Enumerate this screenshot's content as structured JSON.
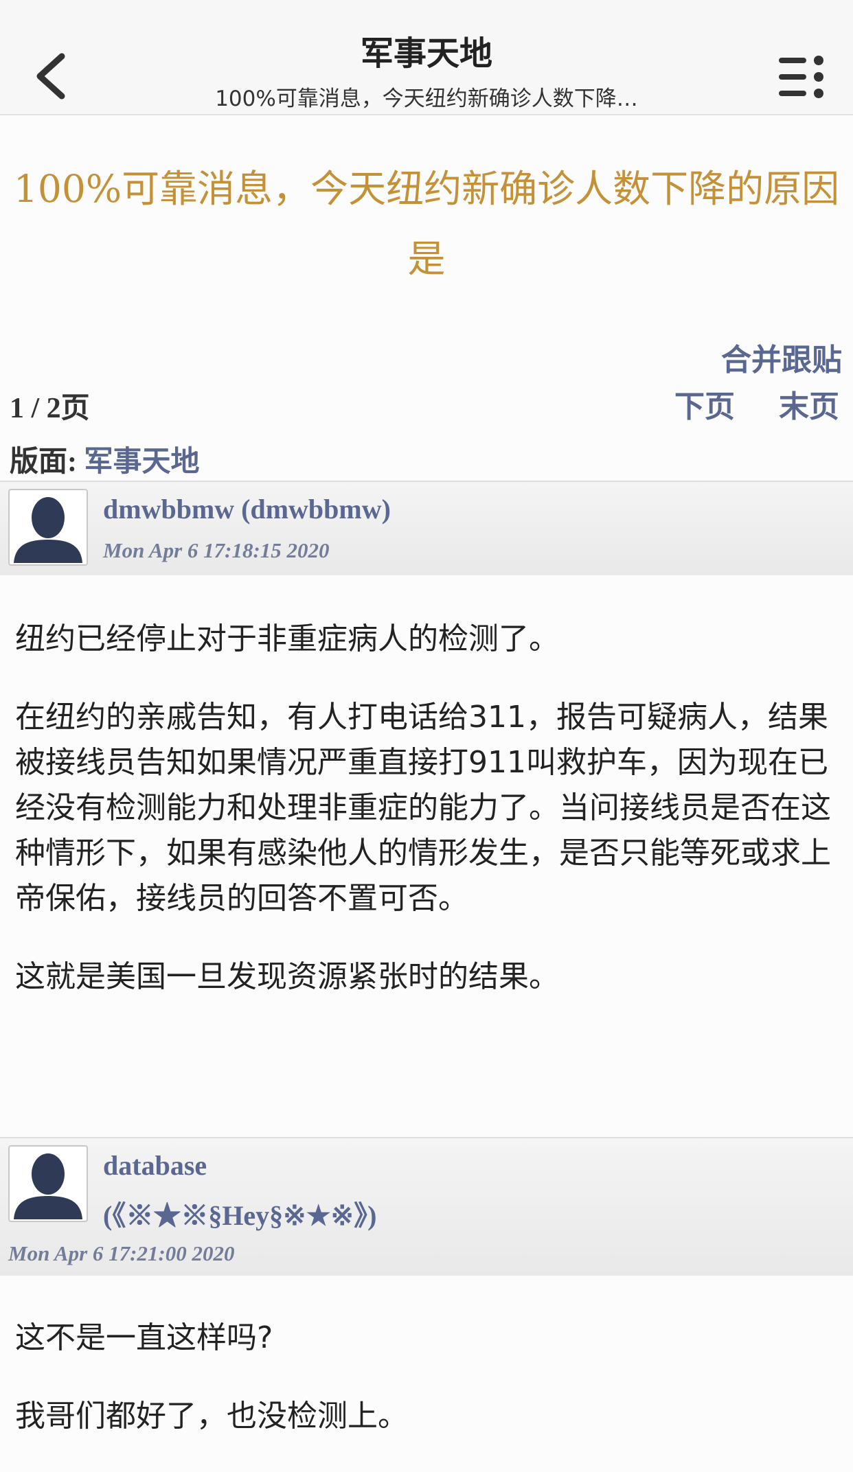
{
  "nav": {
    "title": "军事天地",
    "subtitle": "100%可靠消息，今天纽约新确诊人数下降…"
  },
  "thread": {
    "title": "100%可靠消息，今天纽约新确诊人数下降的原因是",
    "merge_label": "合并跟贴",
    "page_info": "1 / 2页",
    "next_label": "下页",
    "last_label": "末页",
    "board_label": "版面:",
    "board_name": "军事天地"
  },
  "posts": [
    {
      "author": "dmwbbmw (dmwbbmw)",
      "author_handle": "",
      "time": "Mon Apr 6 17:18:15 2020",
      "paragraphs": [
        "纽约已经停止对于非重症病人的检测了。",
        "在纽约的亲戚告知，有人打电话给311，报告可疑病人，结果被接线员告知如果情况严重直接打911叫救护车，因为现在已经没有检测能力和处理非重症的能力了。当问接线员是否在这种情形下，如果有感染他人的情形发生，是否只能等死或求上帝保佑，接线员的回答不置可否。",
        "这就是美国一旦发现资源紧张时的结果。"
      ]
    },
    {
      "author": "database",
      "author_handle": "(《※★※§Hey§※★※》)",
      "time": "Mon Apr 6 17:21:00 2020",
      "paragraphs": [
        "这不是一直这样吗?",
        "我哥们都好了，也没检测上。"
      ]
    }
  ],
  "icons": {
    "back": "chevron-left-icon",
    "menu": "list-menu-icon",
    "avatar": "default-avatar-icon"
  },
  "colors": {
    "title_gold": "#c49137",
    "link_blue": "#5a6791",
    "time_gray": "#737d99"
  }
}
